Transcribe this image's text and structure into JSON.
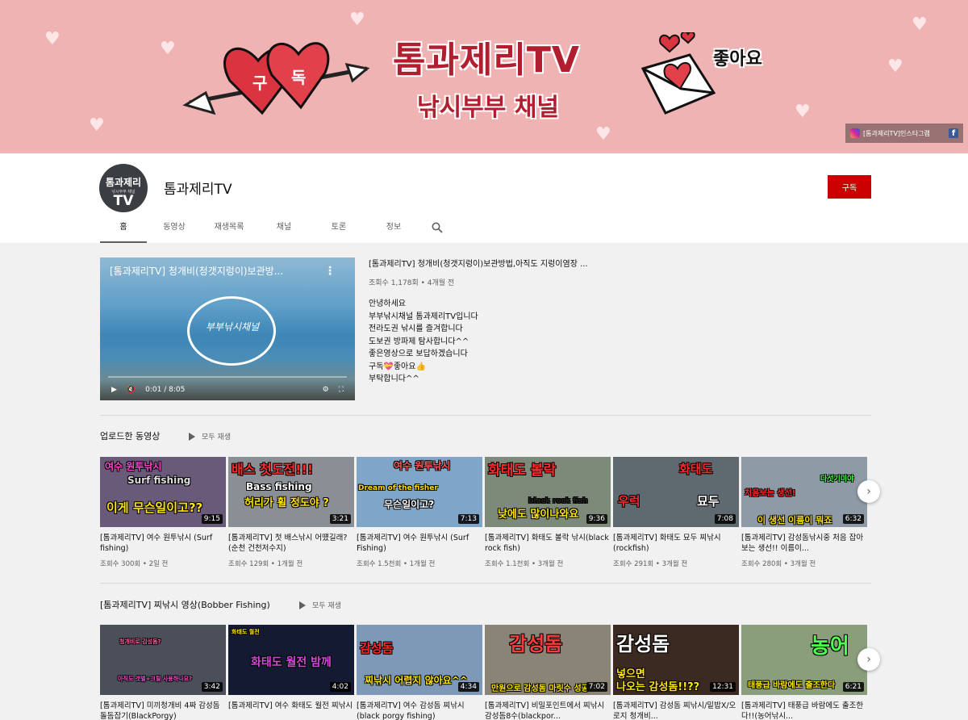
{
  "banner": {
    "title": "톰과제리TV",
    "subtitle": "낚시부부 채널",
    "heart_words": [
      "구",
      "독"
    ],
    "like_text": "좋아요",
    "links_text": "[톰과제리TV]인스타그램"
  },
  "channel": {
    "avatar_top": "톰과제리",
    "avatar_mid": "낚시부부 채널",
    "avatar_bottom": "TV",
    "name": "톰과제리TV",
    "subscribe_label": "구독"
  },
  "tabs": [
    {
      "label": "홈"
    },
    {
      "label": "동영상"
    },
    {
      "label": "재생목록"
    },
    {
      "label": "채널"
    },
    {
      "label": "토론"
    },
    {
      "label": "정보"
    }
  ],
  "featured": {
    "player_title": "[톰과제리TV] 청개비(청갯지렁이)보관방...",
    "cloud_text": "부부낚시채널",
    "time": "0:01 / 8:05",
    "title": "[톰과제리TV] 청개비(청갯지렁이)보관방법,아직도 지렁이염장 ...",
    "meta": "조회수 1,178회 • 4개월 전",
    "description": [
      "안녕하세요",
      "부부낚시채널 톰과제리TV입니다",
      "전라도권 낚시를 즐겨합니다",
      "도보권 방파제 탐사합니다^^",
      "좋은영상으로 보답하겠습니다",
      "구독💝좋아요👍",
      "부탁합니다^^"
    ]
  },
  "sections": [
    {
      "title": "업로드한 동영상",
      "play_all": "모두 재생",
      "videos": [
        {
          "thumb_text": "여수 원투낚시",
          "thumb_text2": "Surf fishing",
          "thumb_text3": "이게 무슨일이고??",
          "duration": "9:15",
          "title": "[톰과제리TV] 여수 원투낚시 (Surf fishing)",
          "meta": "조회수 300회 • 2일 전",
          "bg": "#6a5a7a"
        },
        {
          "thumb_text": "배스 첫도전!!!",
          "thumb_text2": "Bass fishing",
          "thumb_text3": "허리가 휠 정도야 ?",
          "duration": "3:21",
          "title": "[톰과제리TV] 첫 배스낚시 어떘길래?(순천 건천저수지)",
          "meta": "조회수 129회 • 1개월 전",
          "bg": "#8a8f96"
        },
        {
          "thumb_text": "여수 원투낚시",
          "thumb_text2": "Dream of the fisher",
          "thumb_text3": "무슨일이고?",
          "duration": "7:13",
          "title": "[톰과제리TV] 여수 원투낚시 (Surf Fishing)",
          "meta": "조회수 1.5천회 • 1개월 전",
          "bg": "#7fa6c8"
        },
        {
          "thumb_text": "화태도 볼락",
          "thumb_text2": "black rock fish",
          "thumb_text3": "낮에도 많이나와요",
          "duration": "9:36",
          "title": "[톰과제리TV] 화태도 볼락 낚시(black rock fish)",
          "meta": "조회수 1.1천회 • 3개월 전",
          "bg": "#7d8a7a"
        },
        {
          "thumb_text": "화태도",
          "thumb_text2": "우럭",
          "thumb_text3": "묘두",
          "duration": "7:08",
          "title": "[톰과제리TV] 화태도 묘두 찌낚시(rockfish)",
          "meta": "조회수 291회 • 3개월 전",
          "bg": "#5f6a70"
        },
        {
          "thumb_text": "처음보는 생선!",
          "thumb_text2": "다섯기미야",
          "thumb_text3": "이 생선 이름이 뭐죠",
          "duration": "6:32",
          "title": "[톰과제리TV] 감성돔낚시중 처음 잡아보는 생선!! 이름이...",
          "meta": "조회수 280회 • 3개월 전",
          "bg": "#8e9aa6"
        }
      ]
    },
    {
      "title": "[톰과제리TV] 찌낚시 영상(Bobber Fishing)",
      "play_all": "모두 재생",
      "videos": [
        {
          "thumb_text": "청개비로 감성돔?",
          "thumb_text2": "",
          "thumb_text3": "아직도 갯벌+크릴 사용하나요?",
          "duration": "3:42",
          "title": "[톰과제리TV] 미끼청개비 4짜 감성돔 돌돔잡기(BlackPorgy)",
          "meta": "",
          "bg": "#4b4f5a"
        },
        {
          "thumb_text": "화태도 월전",
          "thumb_text2": "",
          "thumb_text3": "화태도 월전 밤께",
          "duration": "4:02",
          "title": "[톰과제리TV] 여수 화태도 월전 찌낚시",
          "meta": "",
          "bg": "#151a33"
        },
        {
          "thumb_text": "감성돔",
          "thumb_text2": "",
          "thumb_text3": "찌낚시 어렵지 않아요^^",
          "duration": "4:34",
          "title": "[톰과제리TV] 여수 감성돔 찌낚시(black porgy fishing)",
          "meta": "",
          "bg": "#7e98b8"
        },
        {
          "thumb_text": "감성돔",
          "thumb_text2": "",
          "thumb_text3": "만원으로 감성돔 마릿수 성공",
          "duration": "7:02",
          "title": "[톰과제리TV] 비밀포인트에서 찌낚시 감성돔8수(blackpor...",
          "meta": "",
          "bg": "#8a8476"
        },
        {
          "thumb_text": "감성돔",
          "thumb_text2": "넣으면",
          "thumb_text3": "나오는 감성돔!!??",
          "duration": "12:31",
          "title": "[톰과제리TV] 감성돔 찌낚시/밑밥X/오로지 청개비...",
          "meta": "",
          "bg": "#3b2a22"
        },
        {
          "thumb_text": "농어",
          "thumb_text2": "",
          "thumb_text3": "태풍급 바람에도 출조한다",
          "duration": "6:21",
          "title": "[톰과제리TV] 태풍급 바람에도 출조한다!!(농어낚시...",
          "meta": "",
          "bg": "#8a9e7c"
        }
      ]
    }
  ],
  "colors": {
    "subscribe": "#cc0000",
    "banner": "#f0b3b3",
    "banner_text": "#b01e2f"
  }
}
